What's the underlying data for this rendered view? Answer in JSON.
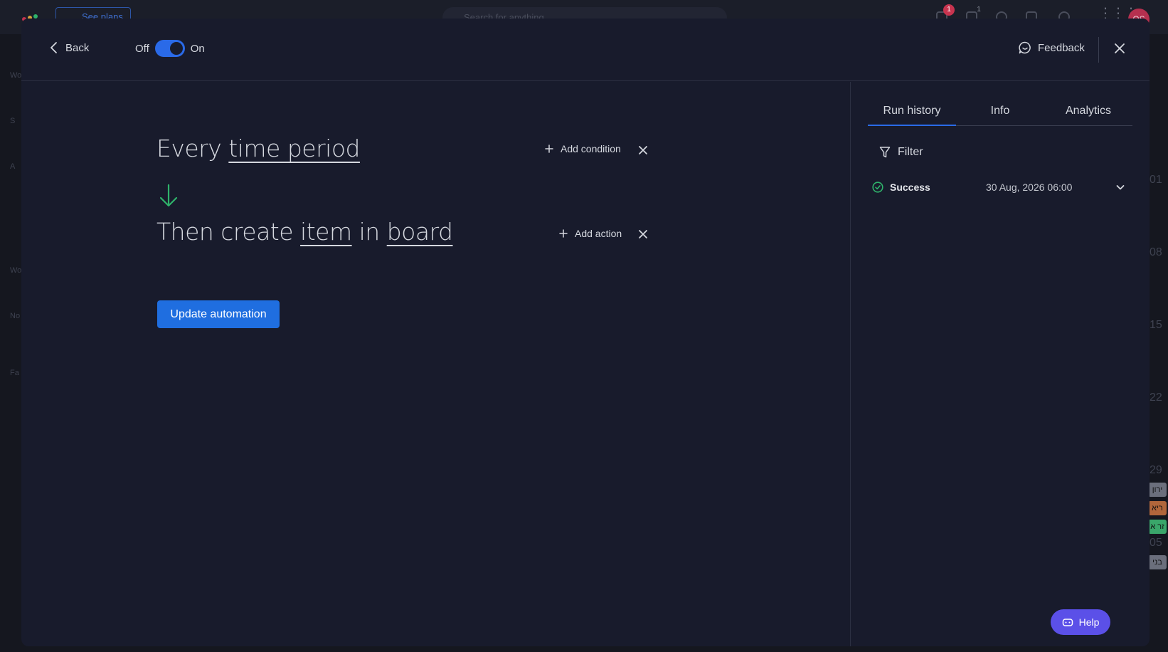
{
  "background": {
    "plans_label": "See plans",
    "search_placeholder": "Search for anything",
    "notification_count": "1",
    "inbox_count": "1",
    "avatar_initials": "OS",
    "sidebar_fragments": [
      "Wo",
      "S",
      "A",
      "Wo",
      "No",
      "Fa"
    ],
    "calendar_numbers": [
      "01",
      "08",
      "15",
      "22",
      "29",
      "05"
    ],
    "calendar_chips": [
      {
        "text": "ירון",
        "color": "#6b6f7c"
      },
      {
        "text": "ריא",
        "color": "#b0663b"
      },
      {
        "text": "זר א",
        "color": "#3aa66a"
      },
      {
        "text": "בני",
        "color": "#6b6f7c"
      }
    ]
  },
  "header": {
    "back_label": "Back",
    "toggle_off_label": "Off",
    "toggle_on_label": "On",
    "toggle_state": "on",
    "feedback_label": "Feedback"
  },
  "recipe": {
    "trigger_prefix": "Every",
    "trigger_token": "time period",
    "action_prefix": "Then create",
    "action_token_item": "item",
    "action_connector": "in",
    "action_token_board": "board",
    "add_condition_label": "Add condition",
    "add_action_label": "Add action",
    "update_button_label": "Update automation",
    "arrow_color": "#2fb36b"
  },
  "panel": {
    "tabs": [
      {
        "label": "Run history",
        "active": true
      },
      {
        "label": "Info",
        "active": false
      },
      {
        "label": "Analytics",
        "active": false
      }
    ],
    "filter_label": "Filter",
    "runs": [
      {
        "status": "Success",
        "date": "30 Aug, 2026 06:00",
        "status_color": "#2fb36b"
      }
    ]
  },
  "help_label": "Help",
  "colors": {
    "modal_bg": "#181b2c",
    "accent": "#2a6ae8",
    "primary_button": "#1f6ee0",
    "help_button": "#5b50e8"
  }
}
